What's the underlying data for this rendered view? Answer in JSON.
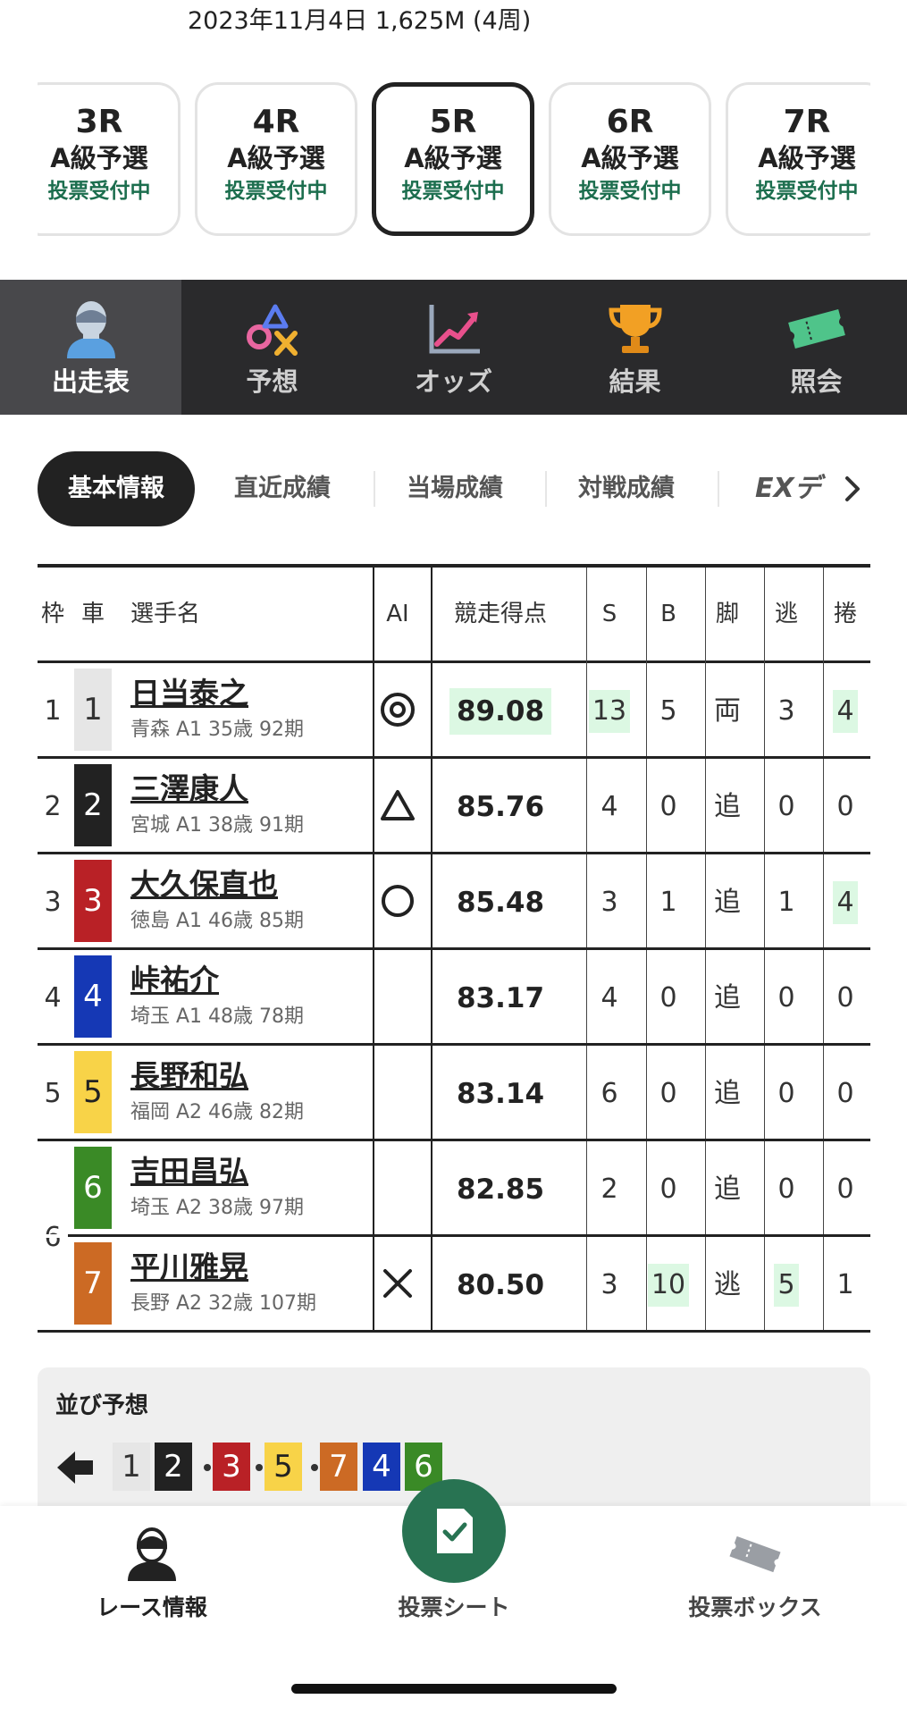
{
  "header": {
    "date_text": "2023年11月4日 1,625M (4周)"
  },
  "races": [
    {
      "no": "3R",
      "cls": "A級予選",
      "status": "投票受付中",
      "active": false
    },
    {
      "no": "4R",
      "cls": "A級予選",
      "status": "投票受付中",
      "active": false
    },
    {
      "no": "5R",
      "cls": "A級予選",
      "status": "投票受付中",
      "active": true
    },
    {
      "no": "6R",
      "cls": "A級予選",
      "status": "投票受付中",
      "active": false
    },
    {
      "no": "7R",
      "cls": "A級予選",
      "status": "投票受付中",
      "active": false
    }
  ],
  "main_nav": [
    {
      "label": "出走表",
      "icon": "rider-icon",
      "active": true
    },
    {
      "label": "予想",
      "icon": "prediction-symbols-icon",
      "active": false
    },
    {
      "label": "オッズ",
      "icon": "odds-chart-icon",
      "active": false
    },
    {
      "label": "結果",
      "icon": "trophy-icon",
      "active": false
    },
    {
      "label": "照会",
      "icon": "ticket-icon",
      "active": false
    }
  ],
  "sub_tabs": [
    {
      "label": "基本情報",
      "active": true
    },
    {
      "label": "直近成績",
      "active": false
    },
    {
      "label": "当場成績",
      "active": false
    },
    {
      "label": "対戦成績",
      "active": false
    },
    {
      "label": "EXデ",
      "active": false
    }
  ],
  "table": {
    "headers": {
      "waku": "枠",
      "car": "車",
      "name": "選手名",
      "ai": "AI",
      "points": "競走得点",
      "s": "S",
      "b": "B",
      "kyaku": "脚",
      "nige": "逃",
      "makuri": "捲"
    },
    "rows": [
      {
        "waku": "1",
        "car": "1",
        "name": "日当泰之",
        "info": "青森 A1 35歳 92期",
        "ai": "double-circle",
        "points": "89.08",
        "points_hl": true,
        "s": "13",
        "s_hl": true,
        "b": "5",
        "b_hl": false,
        "kyaku": "両",
        "nige": "3",
        "nige_hl": false,
        "makuri": "4",
        "makuri_hl": true,
        "car_color": "#e6e6e6",
        "car_text": "#333"
      },
      {
        "waku": "2",
        "car": "2",
        "name": "三澤康人",
        "info": "宮城 A1 38歳 91期",
        "ai": "triangle",
        "points": "85.76",
        "points_hl": false,
        "s": "4",
        "s_hl": false,
        "b": "0",
        "b_hl": false,
        "kyaku": "追",
        "nige": "0",
        "nige_hl": false,
        "makuri": "0",
        "makuri_hl": false,
        "car_color": "#222222",
        "car_text": "#fff"
      },
      {
        "waku": "3",
        "car": "3",
        "name": "大久保直也",
        "info": "徳島 A1 46歳 85期",
        "ai": "circle",
        "points": "85.48",
        "points_hl": false,
        "s": "3",
        "s_hl": false,
        "b": "1",
        "b_hl": false,
        "kyaku": "追",
        "nige": "1",
        "nige_hl": false,
        "makuri": "4",
        "makuri_hl": true,
        "car_color": "#b92126",
        "car_text": "#fff"
      },
      {
        "waku": "4",
        "car": "4",
        "name": "峠祐介",
        "info": "埼玉 A1 48歳 78期",
        "ai": "",
        "points": "83.17",
        "points_hl": false,
        "s": "4",
        "s_hl": false,
        "b": "0",
        "b_hl": false,
        "kyaku": "追",
        "nige": "0",
        "nige_hl": false,
        "makuri": "0",
        "makuri_hl": false,
        "car_color": "#1538b5",
        "car_text": "#fff"
      },
      {
        "waku": "5",
        "car": "5",
        "name": "長野和弘",
        "info": "福岡 A2 46歳 82期",
        "ai": "",
        "points": "83.14",
        "points_hl": false,
        "s": "6",
        "s_hl": false,
        "b": "0",
        "b_hl": false,
        "kyaku": "追",
        "nige": "0",
        "nige_hl": false,
        "makuri": "0",
        "makuri_hl": false,
        "car_color": "#f8d348",
        "car_text": "#222"
      },
      {
        "waku": "6",
        "car": "6",
        "name": "吉田昌弘",
        "info": "埼玉 A2 38歳 97期",
        "ai": "",
        "points": "82.85",
        "points_hl": false,
        "s": "2",
        "s_hl": false,
        "b": "0",
        "b_hl": false,
        "kyaku": "追",
        "nige": "0",
        "nige_hl": false,
        "makuri": "0",
        "makuri_hl": false,
        "car_color": "#3a8a26",
        "car_text": "#fff"
      },
      {
        "waku": "6",
        "car": "7",
        "name": "平川雅晃",
        "info": "長野 A2 32歳 107期",
        "ai": "cross",
        "points": "80.50",
        "points_hl": false,
        "s": "3",
        "s_hl": false,
        "b": "10",
        "b_hl": true,
        "kyaku": "逃",
        "nige": "5",
        "nige_hl": true,
        "makuri": "1",
        "makuri_hl": false,
        "car_color": "#cc6a24",
        "car_text": "#fff"
      }
    ]
  },
  "narabi": {
    "title": "並び予想",
    "sequence": [
      {
        "n": "1",
        "bg": "#e6e6e6",
        "fg": "#333"
      },
      {
        "n": "2",
        "bg": "#222222",
        "fg": "#fff"
      },
      {
        "n": "3",
        "bg": "#b92126",
        "fg": "#fff"
      },
      {
        "n": "5",
        "bg": "#f8d348",
        "fg": "#222"
      },
      {
        "n": "7",
        "bg": "#cc6a24",
        "fg": "#fff"
      },
      {
        "n": "4",
        "bg": "#1538b5",
        "fg": "#fff"
      },
      {
        "n": "6",
        "bg": "#3a8a26",
        "fg": "#fff"
      }
    ]
  },
  "bottom_nav": [
    {
      "label": "レース情報",
      "icon": "rider-icon",
      "active": true
    },
    {
      "label": "投票シート",
      "icon": "check-sheet-icon",
      "active": false
    },
    {
      "label": "投票ボックス",
      "icon": "ticket-icon",
      "active": false
    }
  ],
  "colors": {
    "accent_green": "#1c6e4e",
    "highlight": "#dcf8e3",
    "nav_bg": "#2a2a2c"
  }
}
